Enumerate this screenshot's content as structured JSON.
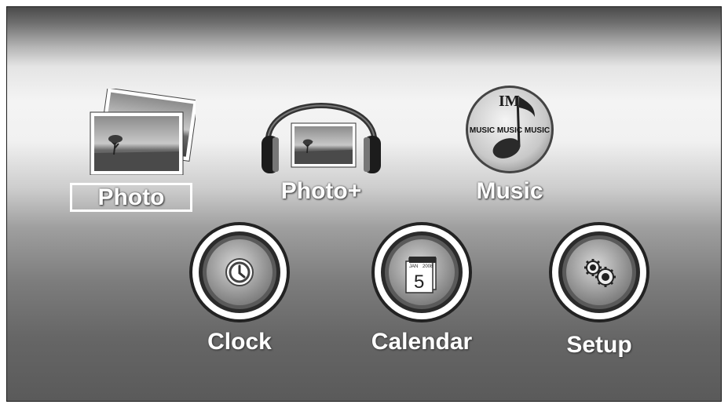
{
  "menu": {
    "items": [
      {
        "label": "Photo"
      },
      {
        "label": "Photo+"
      },
      {
        "label": "Music"
      },
      {
        "label": "Clock"
      },
      {
        "label": "Calendar"
      },
      {
        "label": "Setup"
      }
    ],
    "selected_index": 0
  },
  "music_badge": {
    "logo": "IM",
    "text": "MUSIC MUSIC MUSIC"
  },
  "calendar_icon": {
    "month": "JAN",
    "year": "2008",
    "day": "5"
  },
  "icons": {
    "photo": "photo-stack-icon",
    "photo_plus": "headphones-photo-icon",
    "music": "music-note-icon",
    "clock": "clock-icon",
    "calendar": "calendar-icon",
    "setup": "gears-icon"
  }
}
